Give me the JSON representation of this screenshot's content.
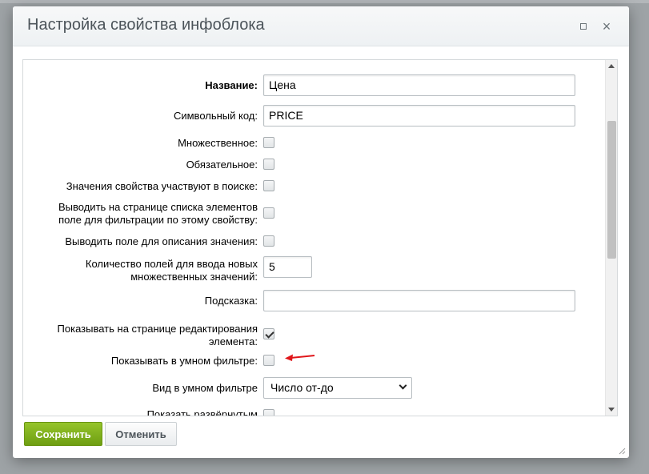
{
  "dialog": {
    "title": "Настройка свойства инфоблока",
    "maximize_icon": "maximize-icon",
    "close_icon": "close-icon",
    "close_glyph": "×"
  },
  "form": {
    "name": {
      "label": "Название:",
      "value": "Цена"
    },
    "code": {
      "label": "Символьный код:",
      "value": "PRICE"
    },
    "multiple": {
      "label": "Множественное:",
      "checked": false
    },
    "required": {
      "label": "Обязательное:",
      "checked": false
    },
    "searchable": {
      "label": "Значения свойства участвуют в поиске:",
      "checked": false
    },
    "filter_list": {
      "label_line1": "Выводить на странице списка элементов",
      "label_line2": "поле для фильтрации по этому свойству:",
      "checked": false
    },
    "with_description": {
      "label": "Выводить поле для описания значения:",
      "checked": false
    },
    "multiple_count": {
      "label_line1": "Количество полей для ввода новых",
      "label_line2": "множественных значений:",
      "value": "5"
    },
    "hint": {
      "label": "Подсказка:",
      "value": ""
    },
    "show_on_edit": {
      "label_line1": "Показывать на странице редактирования",
      "label_line2": "элемента:",
      "checked": true
    },
    "smart_filter": {
      "label": "Показывать в умном фильтре:",
      "checked": false
    },
    "smart_filter_view": {
      "label": "Вид в умном фильтре",
      "selected": "Число от-до"
    },
    "show_expanded": {
      "label": "Показать развёрнутым",
      "checked": false
    }
  },
  "footer": {
    "save_label": "Сохранить",
    "cancel_label": "Отменить"
  },
  "colors": {
    "save_button": "#7fb01c",
    "annotation_arrow": "#e0161a"
  }
}
